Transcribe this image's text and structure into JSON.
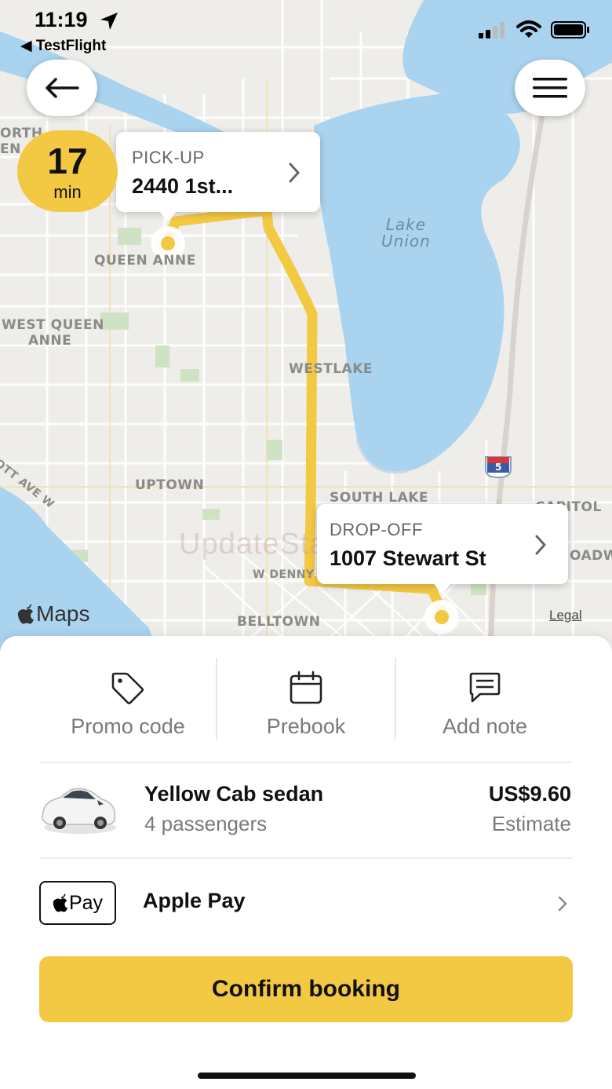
{
  "status_bar": {
    "time": "11:19",
    "back_app": "TestFlight",
    "icons": [
      "location-arrow-icon",
      "cellular-signal-icon",
      "wifi-icon",
      "battery-icon"
    ]
  },
  "map": {
    "labels": {
      "north": "ORTH",
      "north2": "EN AVE",
      "queen_anne": "QUEEN ANNE",
      "west_queen_anne_1": "WEST QUEEN",
      "west_queen_anne_2": "ANNE",
      "westlake": "WESTLAKE",
      "lake_union_1": "Lake",
      "lake_union_2": "Union",
      "uptown": "UPTOWN",
      "south_lake": "SOUTH LAKE",
      "capitol": "CAPITOL",
      "broadway": "OADW",
      "w_denny": "W DENNY",
      "belltown": "BELLTOWN",
      "ave_w": "OTT AVE W",
      "highway": "5"
    },
    "watermark": "UpdateStar.com",
    "maps_brand": "Maps",
    "legal": "Legal"
  },
  "trip": {
    "eta_value": "17",
    "eta_unit": "min",
    "pickup_caption": "PICK-UP",
    "pickup_address": "2440 1st...",
    "dropoff_caption": "DROP-OFF",
    "dropoff_address": "1007 Stewart St"
  },
  "actions": [
    {
      "label": "Promo code",
      "icon": "tag-icon"
    },
    {
      "label": "Prebook",
      "icon": "calendar-icon"
    },
    {
      "label": "Add note",
      "icon": "message-icon"
    }
  ],
  "ride": {
    "name": "Yellow Cab sedan",
    "passengers": "4 passengers",
    "price": "US$9.60",
    "price_note": "Estimate"
  },
  "payment": {
    "badge_text": "Pay",
    "method": "Apple Pay"
  },
  "confirm_label": "Confirm booking",
  "colors": {
    "accent": "#f3c842",
    "water": "#aad3f0",
    "map_background": "#eeede9",
    "route": "#f3c842"
  }
}
